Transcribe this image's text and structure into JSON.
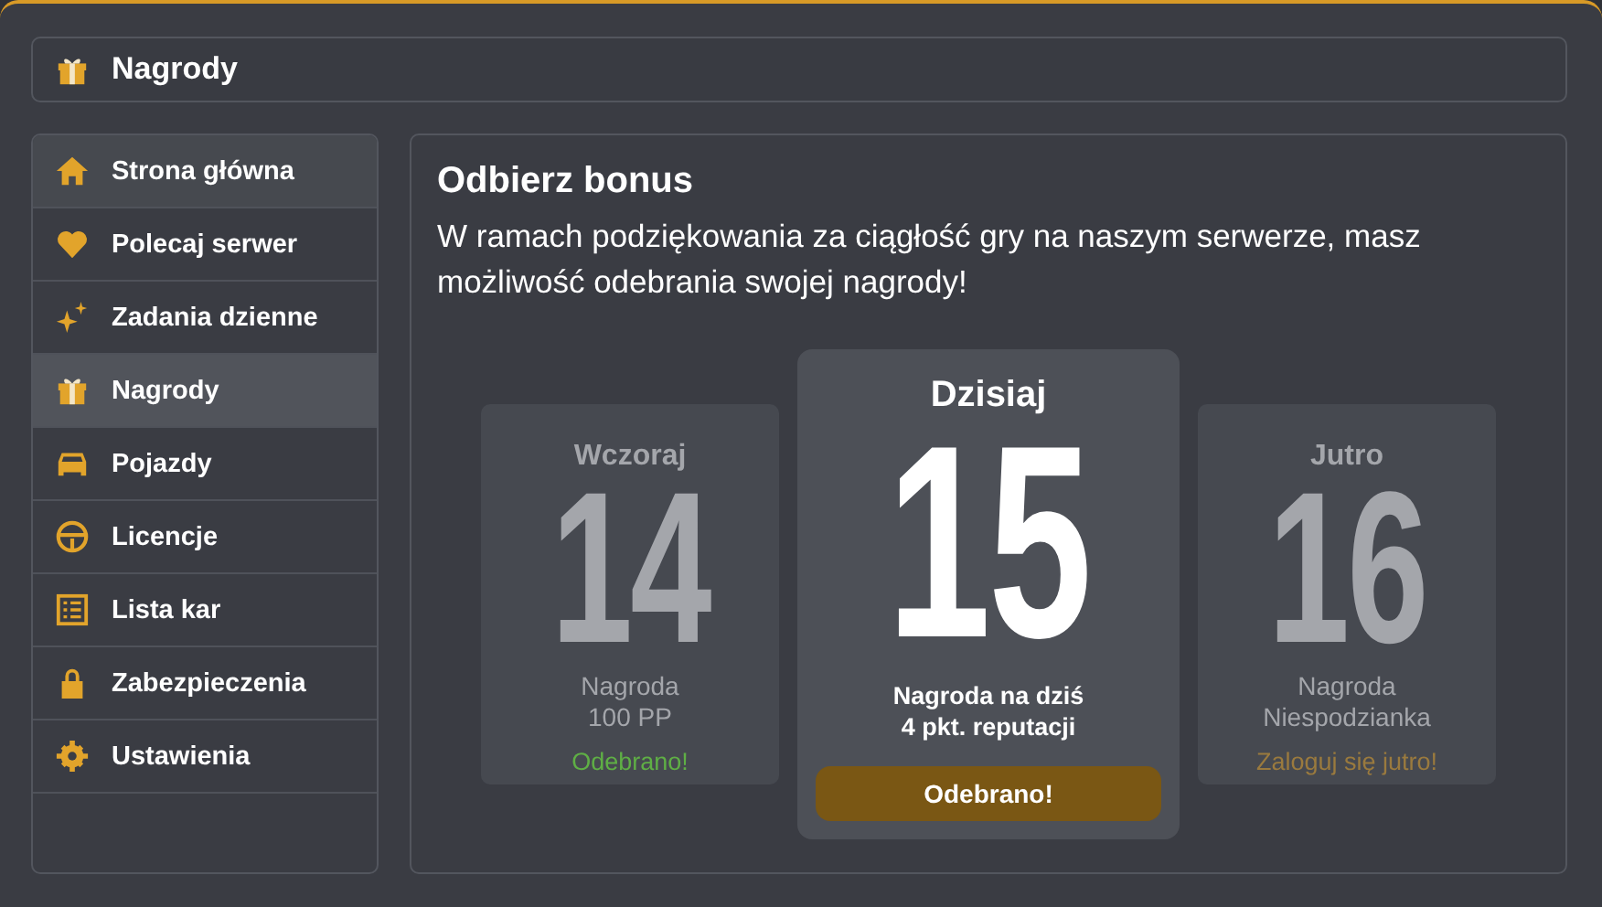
{
  "header": {
    "title": "Nagrody"
  },
  "sidebar": {
    "items": [
      {
        "label": "Strona główna",
        "selected": false,
        "hovered": true
      },
      {
        "label": "Polecaj serwer",
        "selected": false,
        "hovered": false
      },
      {
        "label": "Zadania dzienne",
        "selected": false,
        "hovered": false
      },
      {
        "label": "Nagrody",
        "selected": true,
        "hovered": false
      },
      {
        "label": "Pojazdy",
        "selected": false,
        "hovered": false
      },
      {
        "label": "Licencje",
        "selected": false,
        "hovered": false
      },
      {
        "label": "Lista kar",
        "selected": false,
        "hovered": false
      },
      {
        "label": "Zabezpieczenia",
        "selected": false,
        "hovered": false
      },
      {
        "label": "Ustawienia",
        "selected": false,
        "hovered": false
      }
    ]
  },
  "main": {
    "title": "Odbierz bonus",
    "subtitle": "W ramach podziękowania za ciągłość gry na naszym serwerze, masz możliwość odebrania swojej nagrody!",
    "cards": [
      {
        "kind": "past",
        "day": "Wczoraj",
        "number": "14",
        "reward": [
          "Nagroda",
          "100 PP"
        ],
        "status": "Odebrano!"
      },
      {
        "kind": "today",
        "day": "Dzisiaj",
        "number": "15",
        "reward": [
          "Nagroda na dziś",
          "4 pkt. reputacji"
        ],
        "status": "Odebrano!"
      },
      {
        "kind": "future",
        "day": "Jutro",
        "number": "16",
        "reward": [
          "Nagroda",
          "Niespodzianka"
        ],
        "status": "Zaloguj się jutro!"
      }
    ]
  }
}
